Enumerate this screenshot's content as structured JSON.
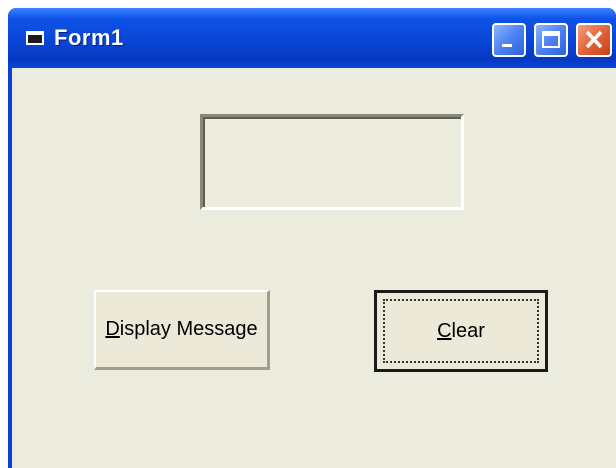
{
  "window": {
    "title": "Form1"
  },
  "titlebar_buttons": [
    {
      "name": "minimize",
      "icon": "minimize-icon"
    },
    {
      "name": "maximize",
      "icon": "maximize-icon"
    },
    {
      "name": "close",
      "icon": "close-icon"
    }
  ],
  "form": {
    "message_box_value": "",
    "display_button": {
      "accelerator": "D",
      "label_rest": "isplay Message"
    },
    "clear_button": {
      "accelerator": "C",
      "label_rest": "lear",
      "focused": true
    }
  },
  "colors": {
    "titlebar_blue": "#0a46d6",
    "form_background": "#ebebde",
    "close_button_red": "#e2643a"
  }
}
